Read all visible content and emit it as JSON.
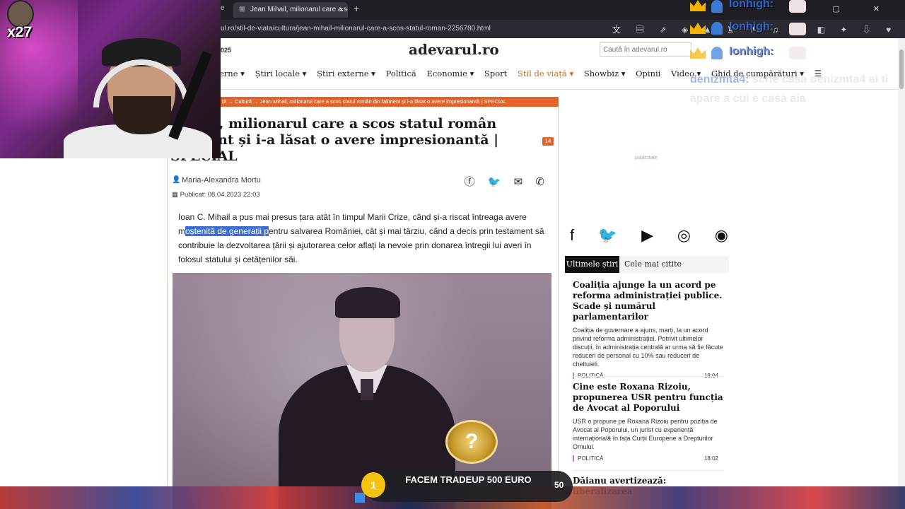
{
  "browser": {
    "tab_prev_fragment": "e",
    "tab_title": "Jean Mihail, milionarul care a sc",
    "tab_close": "×",
    "new_tab": "+",
    "url": "ul.ro/stil-de-viata/cultura/jean-mihail-milionarul-care-a-scos-statul-roman-2256780.html",
    "window_controls": "— ▢ ✕"
  },
  "site": {
    "logo": "adevarul.ro",
    "date_fragment": "025",
    "search_placeholder": "Caută în adevarul.ro",
    "nav": [
      {
        "label": "erne ▾"
      },
      {
        "label": "Știri locale ▾"
      },
      {
        "label": "Știri externe ▾"
      },
      {
        "label": "Politică"
      },
      {
        "label": "Economie ▾"
      },
      {
        "label": "Sport"
      },
      {
        "label": "Stil de viață ▾"
      },
      {
        "label": "Showbiz ▾"
      },
      {
        "label": "Opinii"
      },
      {
        "label": "Video ▾"
      },
      {
        "label": "Ghid de cumpărături ▾"
      }
    ],
    "menu_icon": "☰"
  },
  "article": {
    "breadcrumb": "ță →  Cultură →  Jean Mihail, milionarul care a scos statul român din faliment și i-a lăsat o avere impresionantă | SPECIAL",
    "title_line1": "Mihail, milionarul care a scos statul român",
    "title_line2": "faliment și i-a lăsat o avere impresionantă |",
    "title_line3": "SPECIAL",
    "comment_count": "14",
    "author": "Maria-Alexandra Mortu",
    "published_label": "Publicat:",
    "published_date": "08.04.2023 22:03",
    "share_icons": "ⓕ 🐦 ✉ ✆",
    "para_line1": "Ioan C. Mihail a pus mai presus țara atât în timpul Marii Crize, când și-a riscat întreaga avere",
    "para_line2_pre": "m",
    "para_line2_hl": "oștenită de generații p",
    "para_line2_post": "entru salvarea României, cât și mai târziu, când a decis prin testament să",
    "para_line3": "contribuie la dezvoltarea țării și ajutorarea celor aflați la nevoie prin donarea întregii lui averi în",
    "para_line4": "folosul statului și cetățenilor săi."
  },
  "sidebar": {
    "ad_label": "publicitate",
    "social": [
      "f",
      "🐦",
      "▶",
      "◎",
      "◉"
    ],
    "tab_latest": "Ultimele știri",
    "tab_most_read": "Cele mai citite",
    "news": [
      {
        "title": "Coaliția ajunge la un acord pe reforma administrației publice. Scade și numărul parlamentarilor",
        "desc": "Coaliția de guvernare a ajuns, marți, la un acord privind reforma administrației. Potrivit ultimelor discuții, în administrația centrală ar urma să fie făcute reduceri de personal cu 10% sau reduceri de cheltuieli.",
        "category": "POLITICĂ",
        "time": "18:04"
      },
      {
        "title": "Cine este Roxana Rizoiu, propunerea USR pentru funcția de Avocat al Poporului",
        "desc": "USR o propune pe Roxana Rizoiu pentru poziția de Avocat al Poporului, un jurist cu experiență internațională în fața Curții Europene a Drepturilor Omului.",
        "category": "POLITICĂ",
        "time": "18:02"
      },
      {
        "title": "Dăianu avertizează: liberalizarea",
        "desc": "",
        "category": "",
        "time": ""
      }
    ]
  },
  "stream": {
    "combo": "x27",
    "chat": [
      {
        "name": "Ionhigh:"
      },
      {
        "name": "Ionhigh:"
      },
      {
        "name": "Ionhigh:"
      },
      {
        "name": "denizmta4:",
        "message": "scrie casa denizmta4 ai ti apare a cui e casa aia"
      }
    ],
    "alert_text": "FACEM TRADEUP 500 EURO",
    "alert_position": "1",
    "alert_count": "50",
    "badge_symbol": "?"
  },
  "colors": {
    "accent": "#e2632c",
    "chat_name": "#2f63c9",
    "highlight": "#3d6fd1"
  }
}
